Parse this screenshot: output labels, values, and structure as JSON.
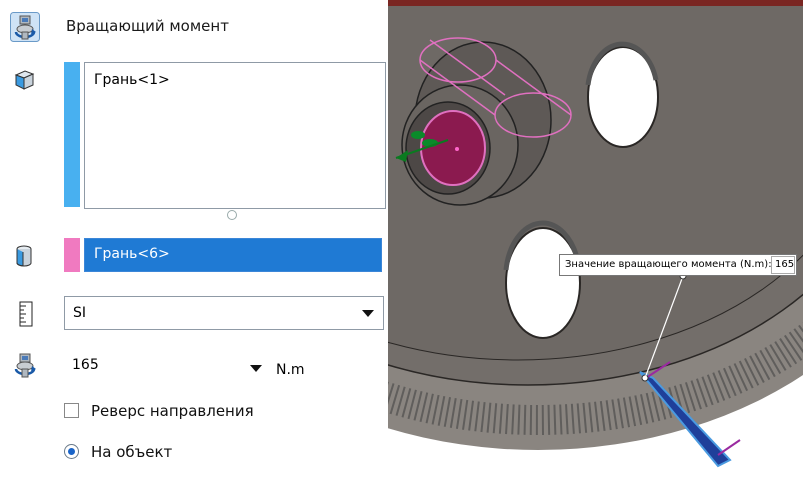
{
  "panel": {
    "title": "Вращающий момент",
    "faces_list": [
      "Грань<1>"
    ],
    "target_face": "Грань<6>",
    "unit_system": "SI",
    "torque_value": "165",
    "torque_unit": "N.m",
    "reverse_label": "Реверс направления",
    "reverse_checked": false,
    "on_object_label": "На объект",
    "on_object_selected": true
  },
  "viewport": {
    "callout_label": "Значение вращающего момента (N.m):",
    "callout_value": "165"
  },
  "colors": {
    "faces_stripe": "#48b0f0",
    "target_stripe": "#f07ac0",
    "selection": "#1f7ad4",
    "gear": "#6b6662",
    "highlight_face": "#8b1a4f",
    "top_bar": "#7a2622"
  }
}
